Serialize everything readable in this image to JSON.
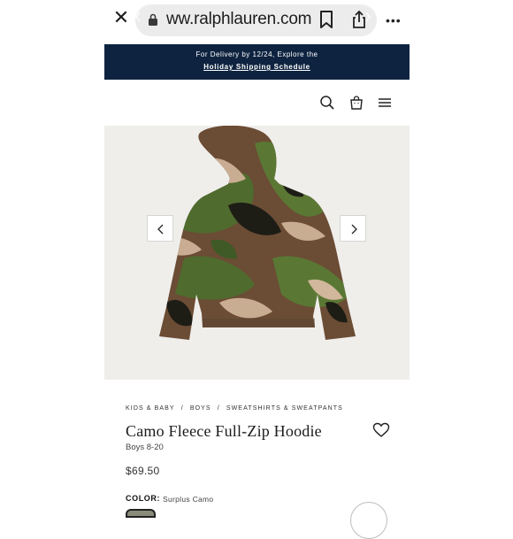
{
  "browser": {
    "url": "ww.ralphlauren.com",
    "close_glyph": "✕",
    "more_glyph": "•••",
    "icons": [
      "close-icon",
      "lock-icon",
      "bookmark-icon",
      "share-icon",
      "more-icon"
    ]
  },
  "promo": {
    "line1": "For Delivery by 12/24, Explore the",
    "line2": "Holiday Shipping Schedule",
    "color": "#0e2340"
  },
  "header": {
    "icons": [
      "search-icon",
      "shopping-bag-icon",
      "menu-icon"
    ]
  },
  "gallery": {
    "icons": [
      "chevron-left-icon",
      "chevron-right-icon"
    ]
  },
  "product": {
    "breadcrumb": [
      "KIDS & BABY",
      "/",
      "BOYS",
      "/",
      "SWEATSHIRTS & SWEATPANTS"
    ],
    "title": "Camo Fleece Full-Zip Hoodie",
    "size_range": "Boys 8-20",
    "price": "$69.50",
    "color_label": "COLOR:",
    "color_value": "Surplus Camo",
    "icons": [
      "heart-icon"
    ]
  }
}
